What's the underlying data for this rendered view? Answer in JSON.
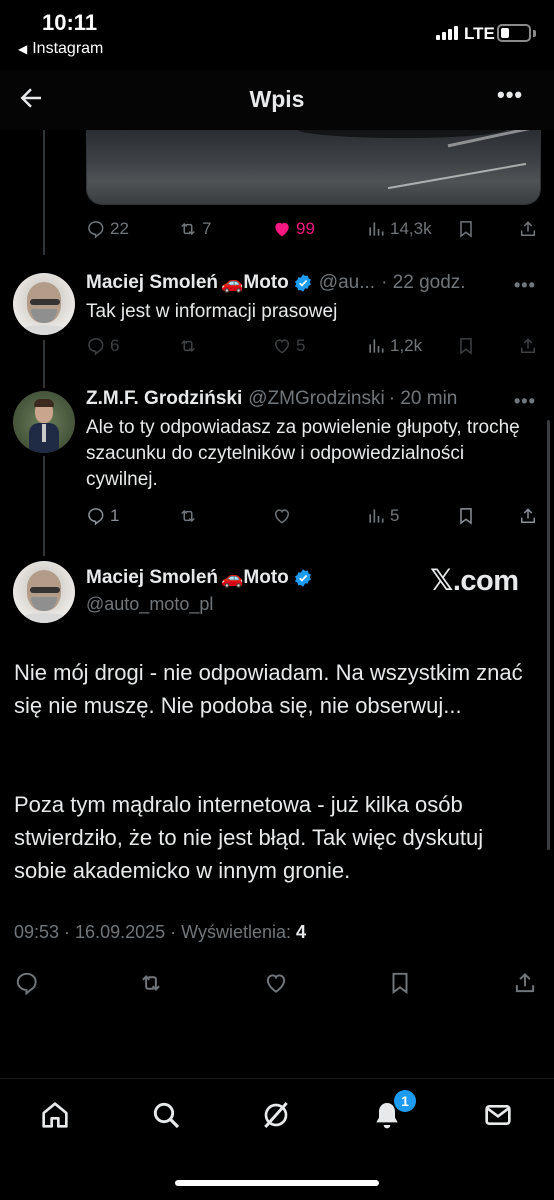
{
  "status_bar": {
    "time": "10:11",
    "back_app": "Instagram",
    "network": "LTE"
  },
  "header": {
    "title": "Wpis",
    "back_icon": "arrow-left-icon",
    "more_icon": "more-horizontal-icon"
  },
  "top_tweet_stats": {
    "replies": "22",
    "retweets": "7",
    "likes": "99",
    "views": "14,3k",
    "like_color": "#f91880"
  },
  "replies": [
    {
      "name": "Maciej Smoleń",
      "name_suffix": "Moto",
      "handle": "@au...",
      "time": "· 22 godz.",
      "verified": true,
      "text": "Tak jest w informacji prasowej",
      "stats": {
        "replies": "6",
        "retweets": "",
        "likes": "5",
        "views": "1,2k"
      }
    },
    {
      "name": "Z.M.F. Grodziński",
      "handle": "@ZMGrodzinski",
      "time": "· 20 min",
      "verified": false,
      "text": "Ale to ty odpowiadasz za powielenie głupoty, trochę szacunku do czytelników i odpowiedzialności cywilnej.",
      "stats": {
        "replies": "1",
        "retweets": "",
        "likes": "",
        "views": "5"
      }
    }
  ],
  "main_tweet": {
    "name": "Maciej Smoleń",
    "name_suffix": "Moto",
    "handle": "@auto_moto_pl",
    "watermark": "𝕏.com",
    "paragraph_1": "Nie mój drogi - nie odpowiadam. Na wszystkim znać się nie muszę. Nie podoba się, nie obserwuj...",
    "paragraph_2": "Poza tym mądralo internetowa - już kilka osób stwierdziło, że to nie jest błąd. Tak więc dyskutuj sobie akademicko w innym gronie.",
    "timestamp": "09:53 · 16.09.2025 · Wyświetlenia:",
    "views": "4"
  },
  "bottom_nav": {
    "items": [
      "home-icon",
      "search-icon",
      "grok-icon",
      "notifications-icon",
      "messages-icon"
    ],
    "notification_badge": "1"
  },
  "colors": {
    "background": "#000000",
    "text": "#e7e9ea",
    "muted": "#71767b",
    "accent": "#1d9bf0",
    "like": "#f91880"
  }
}
